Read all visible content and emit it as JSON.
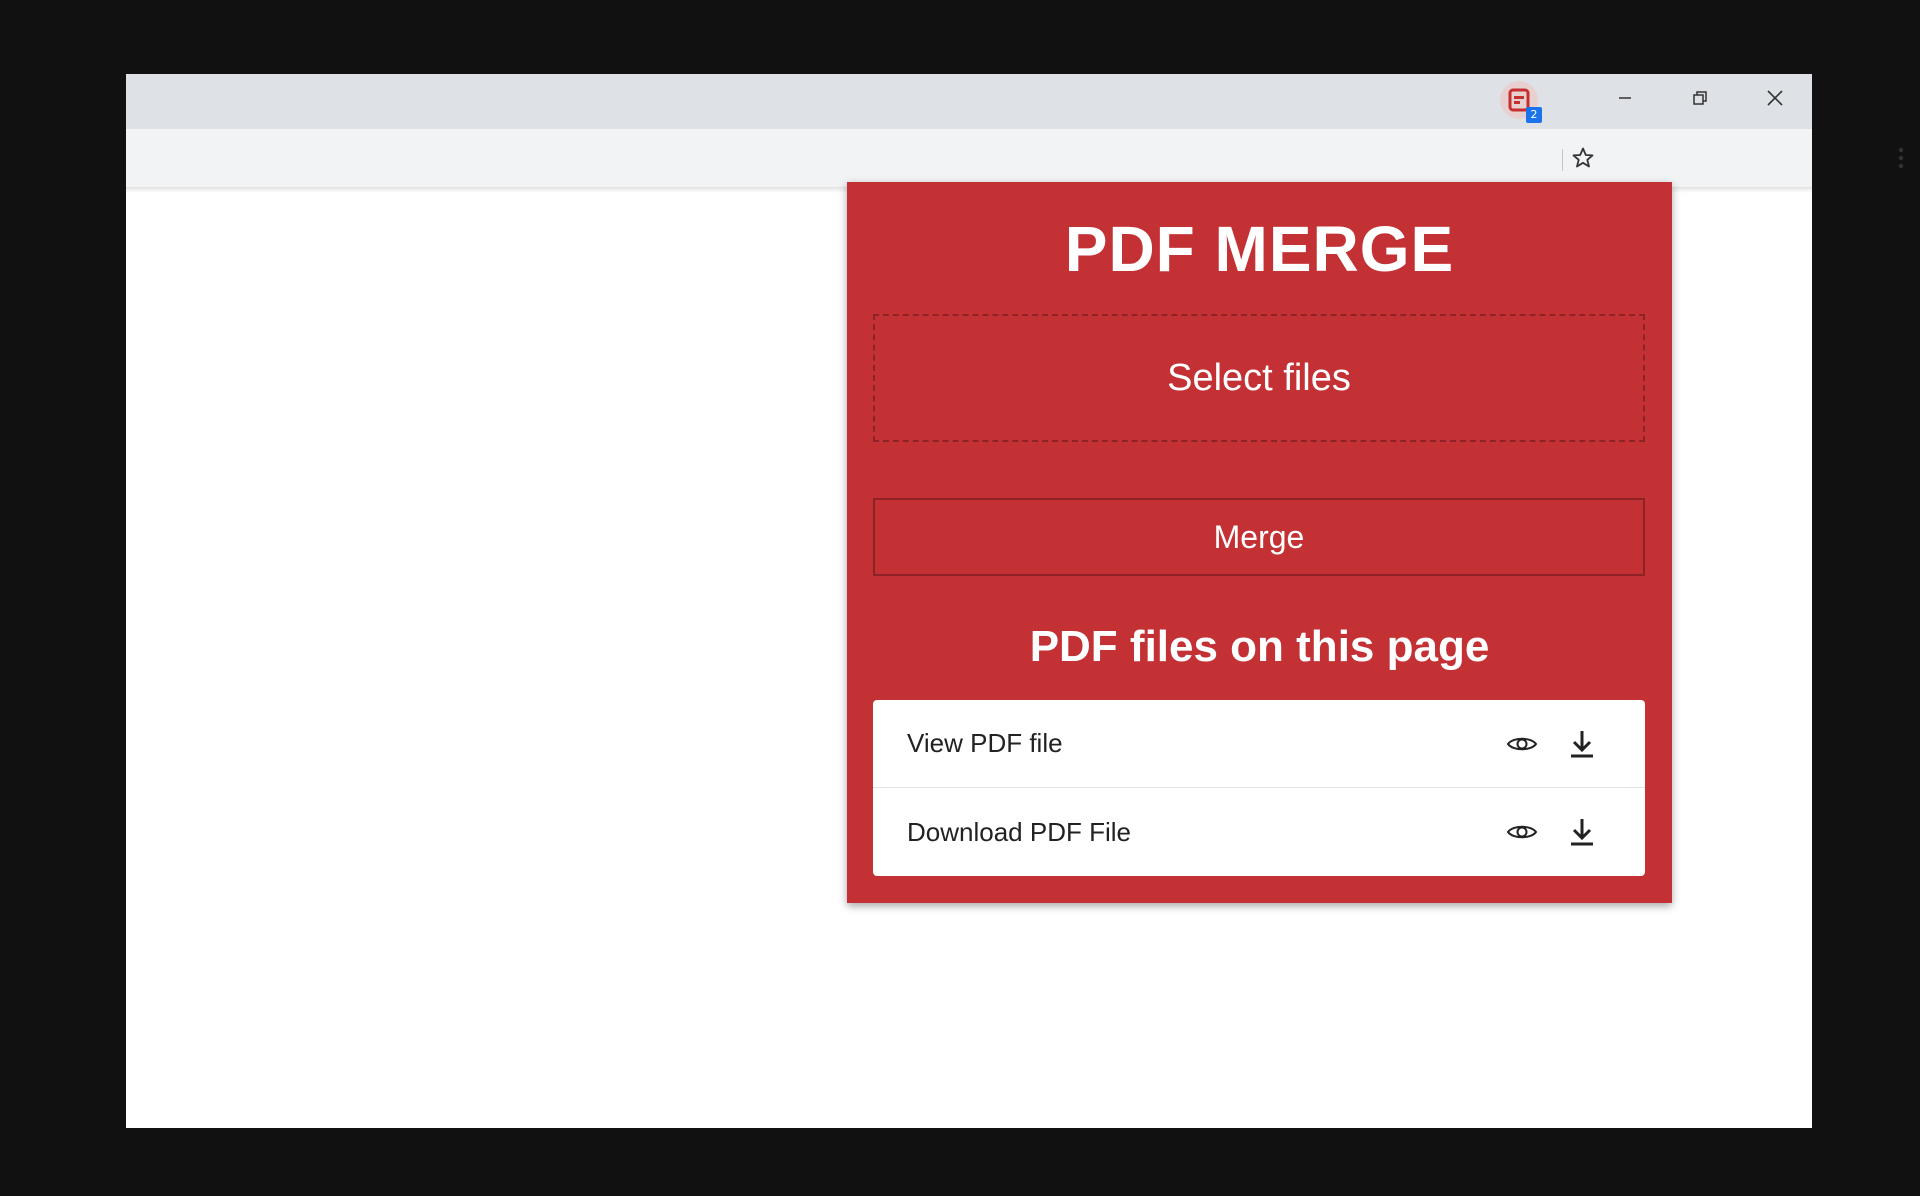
{
  "browser": {
    "window_controls": {
      "minimize_icon": "minimize-icon",
      "restore_icon": "restore-icon",
      "close_icon": "close-icon"
    },
    "toolbar": {
      "bookmark_icon": "star-icon",
      "extension_icon": "pdf-merge-extension-icon",
      "extension_badge": "2",
      "menu_icon": "kebab-menu-icon"
    }
  },
  "popup": {
    "title": "PDF MERGE",
    "select_files_label": "Select files",
    "merge_label": "Merge",
    "section_heading": "PDF files on this page",
    "files": [
      {
        "label": "View PDF file",
        "view_icon": "eye-icon",
        "download_icon": "download-icon"
      },
      {
        "label": "Download PDF File",
        "view_icon": "eye-icon",
        "download_icon": "download-icon"
      }
    ],
    "colors": {
      "background": "#c33135",
      "border": "#8f2226",
      "text": "#ffffff",
      "list_background": "#ffffff"
    }
  }
}
